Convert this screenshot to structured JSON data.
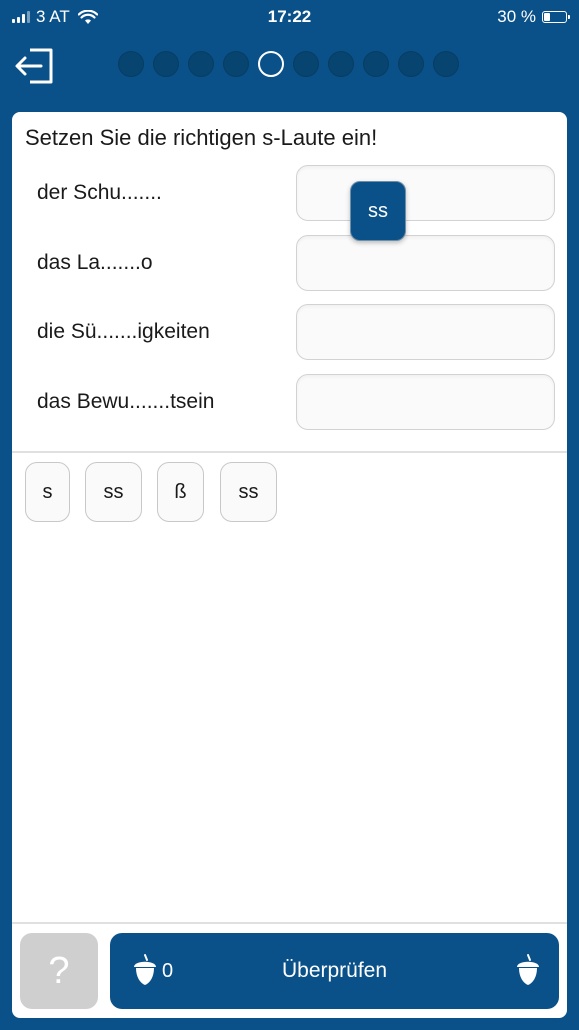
{
  "status_bar": {
    "carrier": "3 AT",
    "time": "17:22",
    "battery": "30 %",
    "battery_level": 0.3
  },
  "progress": {
    "total_steps": 10,
    "current_step": 5
  },
  "exercise": {
    "instruction": "Setzen Sie die richtigen s-Laute ein!",
    "items": [
      {
        "label": "der Schu......."
      },
      {
        "label": "das La.......o"
      },
      {
        "label": "die Sü.......igkeiten"
      },
      {
        "label": "das Bewu.......tsein"
      }
    ],
    "tiles": [
      {
        "label": "s"
      },
      {
        "label": "ss"
      },
      {
        "label": "ß"
      },
      {
        "label": "ss"
      }
    ],
    "dragging_tile": {
      "label": "ss"
    }
  },
  "bottom_bar": {
    "help_label": "?",
    "check_label": "Überprüfen",
    "acorn_count": "0"
  },
  "colors": {
    "primary": "#0a5189",
    "help_button": "#cfcfcf"
  },
  "icons": {
    "exit": "exit-icon",
    "acorn": "acorn-icon",
    "wifi": "wifi-icon"
  }
}
